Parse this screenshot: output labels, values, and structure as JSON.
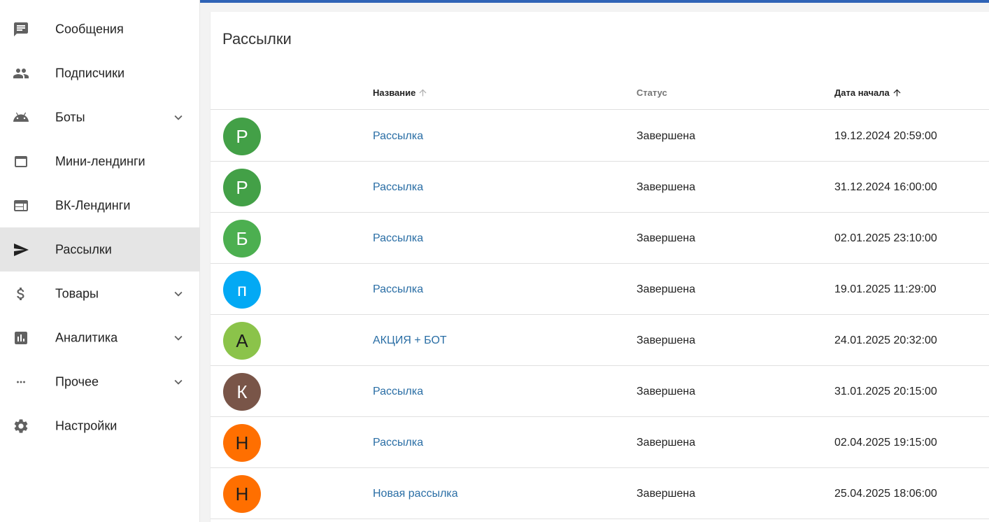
{
  "sidebar": {
    "items": [
      {
        "label": "Сообщения",
        "icon": "message-icon",
        "chevron": false,
        "active": false
      },
      {
        "label": "Подписчики",
        "icon": "people-icon",
        "chevron": false,
        "active": false
      },
      {
        "label": "Боты",
        "icon": "android-icon",
        "chevron": true,
        "active": false
      },
      {
        "label": "Мини-лендинги",
        "icon": "window-icon",
        "chevron": false,
        "active": false
      },
      {
        "label": "ВК-Лендинги",
        "icon": "web-layout-icon",
        "chevron": false,
        "active": false
      },
      {
        "label": "Рассылки",
        "icon": "send-icon",
        "chevron": false,
        "active": true
      },
      {
        "label": "Товары",
        "icon": "dollar-icon",
        "chevron": true,
        "active": false
      },
      {
        "label": "Аналитика",
        "icon": "analytics-icon",
        "chevron": true,
        "active": false
      },
      {
        "label": "Прочее",
        "icon": "more-horiz-icon",
        "chevron": true,
        "active": false
      },
      {
        "label": "Настройки",
        "icon": "gear-icon",
        "chevron": false,
        "active": false
      }
    ]
  },
  "main": {
    "title": "Рассылки",
    "columns": {
      "name": "Название",
      "status": "Статус",
      "date": "Дата начала"
    },
    "rows": [
      {
        "initial": "Р",
        "color": "#43a047",
        "dark": false,
        "name": "Рассылка",
        "status": "Завершена",
        "date": "19.12.2024 20:59:00"
      },
      {
        "initial": "Р",
        "color": "#43a047",
        "dark": false,
        "name": "Рассылка",
        "status": "Завершена",
        "date": "31.12.2024 16:00:00"
      },
      {
        "initial": "Б",
        "color": "#4caf50",
        "dark": false,
        "name": "Рассылка",
        "status": "Завершена",
        "date": "02.01.2025 23:10:00"
      },
      {
        "initial": "п",
        "color": "#03a9f4",
        "dark": false,
        "name": "Рассылка",
        "status": "Завершена",
        "date": "19.01.2025 11:29:00"
      },
      {
        "initial": "А",
        "color": "#8bc34a",
        "dark": true,
        "name": "АКЦИЯ + БОТ",
        "status": "Завершена",
        "date": "24.01.2025 20:32:00"
      },
      {
        "initial": "К",
        "color": "#795548",
        "dark": false,
        "name": "Рассылка",
        "status": "Завершена",
        "date": "31.01.2025 20:15:00"
      },
      {
        "initial": "Н",
        "color": "#ff6f00",
        "dark": true,
        "name": "Рассылка",
        "status": "Завершена",
        "date": "02.04.2025 19:15:00"
      },
      {
        "initial": "Н",
        "color": "#ff6f00",
        "dark": true,
        "name": "Новая рассылка",
        "status": "Завершена",
        "date": "25.04.2025 18:06:00"
      }
    ]
  },
  "colors": {
    "accent_bar": "#2f63b6",
    "link": "#2a6ea5",
    "active_nav_bg": "#e5e5e5"
  }
}
